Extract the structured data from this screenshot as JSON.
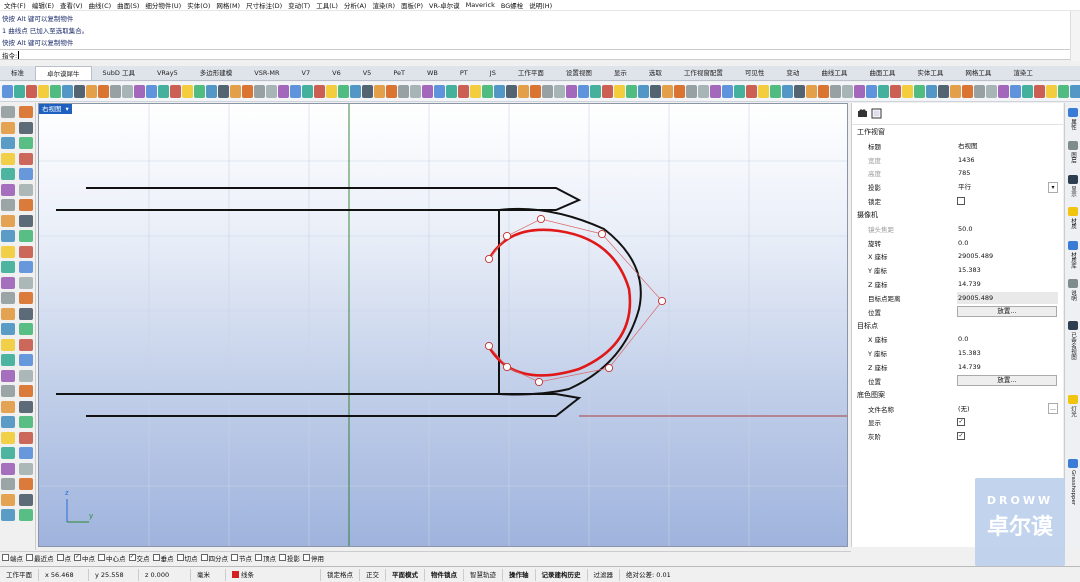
{
  "menu": [
    "文件(F)",
    "编辑(E)",
    "查看(V)",
    "曲线(C)",
    "曲面(S)",
    "细分物件(U)",
    "实体(O)",
    "网格(M)",
    "尺寸标注(D)",
    "变动(T)",
    "工具(L)",
    "分析(A)",
    "渲染(R)",
    "面板(P)",
    "VR-卓尔谟",
    "Maverick",
    "BG螺栓",
    "说明(H)"
  ],
  "command_history": [
    "快按 Alt 键可以复制物件",
    "1 曲线点 已加入至选取集合。",
    "快按 Alt 键可以复制物件"
  ],
  "command_prompt": "指令:",
  "tabs": [
    "标准",
    "卓尔谟犀牛",
    "SubD 工具",
    "VRay5",
    "多边形建模",
    "VSR-MR",
    "V7",
    "V6",
    "V5",
    "PeT",
    "WB",
    "PT",
    "JS",
    "工作平面",
    "设置视图",
    "显示",
    "选取",
    "工作视窗配置",
    "可见性",
    "变动",
    "曲线工具",
    "曲面工具",
    "实体工具",
    "网格工具",
    "渲染工"
  ],
  "active_tab_index": 1,
  "viewport": {
    "title": "右视图",
    "title_arrow": "▾",
    "axis_x": "y",
    "axis_y": "z"
  },
  "panel": {
    "section_viewport": "工作视窗",
    "title_label": "标题",
    "title_value": "右视图",
    "width_label": "宽度",
    "width_value": "1436",
    "height_label": "高度",
    "height_value": "785",
    "projection_label": "投影",
    "projection_value": "平行",
    "lock_label": "锁定",
    "section_camera": "摄像机",
    "focal_label": "镜头焦距",
    "focal_value": "50.0",
    "rotation_label": "旋转",
    "rotation_value": "0.0",
    "cam_x_label": "X 座标",
    "cam_x_value": "29005.489",
    "cam_y_label": "Y 座标",
    "cam_y_value": "15.383",
    "cam_z_label": "Z 座标",
    "cam_z_value": "14.739",
    "target_dist_label": "目标点距离",
    "target_dist_value": "29005.489",
    "position_label": "位置",
    "place_button": "放置...",
    "section_target": "目标点",
    "tgt_x_label": "X 座标",
    "tgt_x_value": "0.0",
    "tgt_y_label": "Y 座标",
    "tgt_y_value": "15.383",
    "tgt_z_label": "Z 座标",
    "tgt_z_value": "14.739",
    "tgt_position_label": "位置",
    "tgt_place_button": "放置...",
    "section_wallpaper": "底色图案",
    "filename_label": "文件名称",
    "filename_value": "(无)",
    "browse_button": "...",
    "show_label": "显示",
    "gray_label": "灰阶"
  },
  "side_tabs": [
    "属性",
    "图层",
    "显示",
    "材质",
    "材质库",
    "说明",
    "已命名视图",
    "灯光",
    "Grasshopper"
  ],
  "osnap": [
    {
      "label": "端点",
      "checked": false
    },
    {
      "label": "最近点",
      "checked": false
    },
    {
      "label": "点",
      "checked": false
    },
    {
      "label": "中点",
      "checked": true
    },
    {
      "label": "中心点",
      "checked": false
    },
    {
      "label": "交点",
      "checked": true
    },
    {
      "label": "垂点",
      "checked": false
    },
    {
      "label": "切点",
      "checked": false
    },
    {
      "label": "四分点",
      "checked": false
    },
    {
      "label": "节点",
      "checked": false
    },
    {
      "label": "顶点",
      "checked": false
    },
    {
      "label": "投影",
      "checked": false
    },
    {
      "label": "停用",
      "checked": false
    }
  ],
  "status": {
    "plane": "工作平面",
    "x": "x 56.468",
    "y": "y 25.558",
    "z": "z 0.000",
    "unit": "毫米",
    "layer": "线条",
    "lock_grid": "锁定格点",
    "ortho": "正交",
    "planar": "平面模式",
    "osnap": "物件锁点",
    "smarttrack": "智慧轨迹",
    "gumball": "操作轴",
    "history": "记录建构历史",
    "filter": "过滤器",
    "tolerance": "绝对公差: 0.01"
  },
  "watermark": {
    "line1": "DROWW",
    "line2": "卓尔谟"
  },
  "colors": {
    "accent": "#1e5fbf",
    "curve_red": "#e01818",
    "grid_axis_red": "#b04040",
    "grid_axis_green": "#2a7a2a"
  }
}
